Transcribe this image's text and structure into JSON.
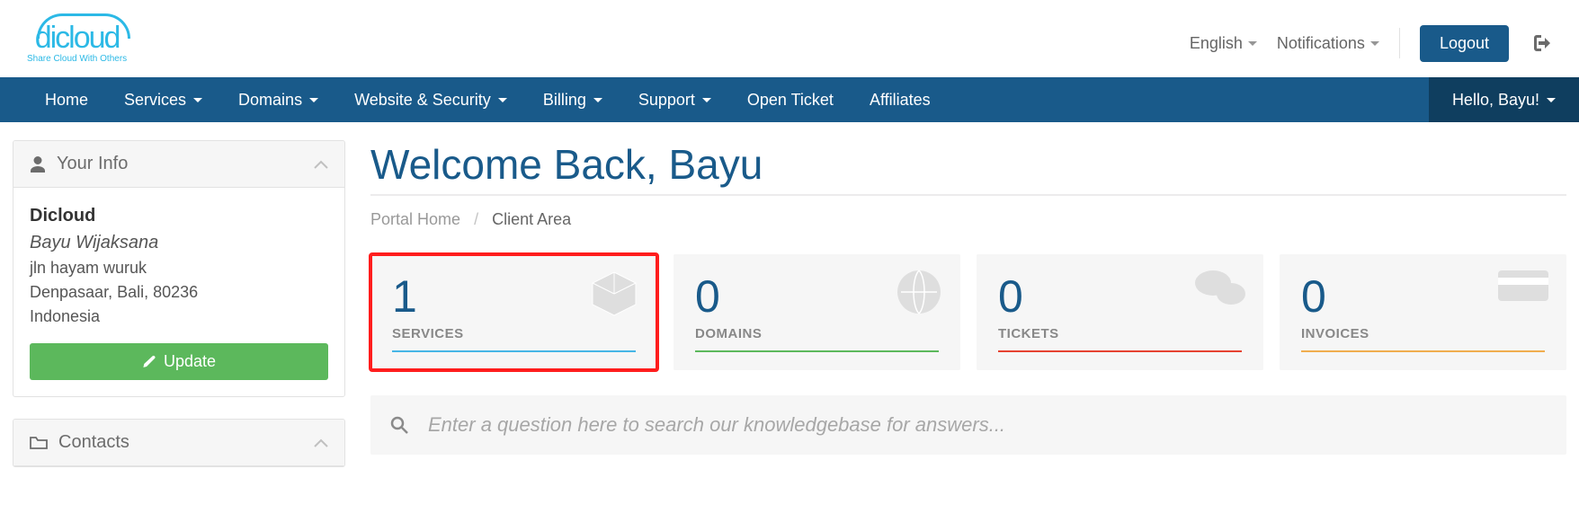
{
  "top": {
    "language": "English",
    "notifications": "Notifications",
    "logout": "Logout",
    "logo_main": "dicloud",
    "logo_tag": "Share Cloud With Others"
  },
  "nav": {
    "home": "Home",
    "services": "Services",
    "domains": "Domains",
    "website_security": "Website & Security",
    "billing": "Billing",
    "support": "Support",
    "open_ticket": "Open Ticket",
    "affiliates": "Affiliates",
    "hello_user": "Hello, Bayu!"
  },
  "sidebar": {
    "your_info": {
      "title": "Your Info",
      "company": "Dicloud",
      "name": "Bayu Wijaksana",
      "addr1": "jln hayam wuruk",
      "addr2": "Denpasaar, Bali, 80236",
      "addr3": "Indonesia",
      "update": "Update"
    },
    "contacts": {
      "title": "Contacts"
    }
  },
  "main": {
    "title": "Welcome Back, Bayu",
    "breadcrumb": {
      "root": "Portal Home",
      "active": "Client Area"
    },
    "stats": {
      "services": {
        "value": "1",
        "label": "SERVICES"
      },
      "domains": {
        "value": "0",
        "label": "DOMAINS"
      },
      "tickets": {
        "value": "0",
        "label": "TICKETS"
      },
      "invoices": {
        "value": "0",
        "label": "INVOICES"
      }
    },
    "search_placeholder": "Enter a question here to search our knowledgebase for answers..."
  }
}
